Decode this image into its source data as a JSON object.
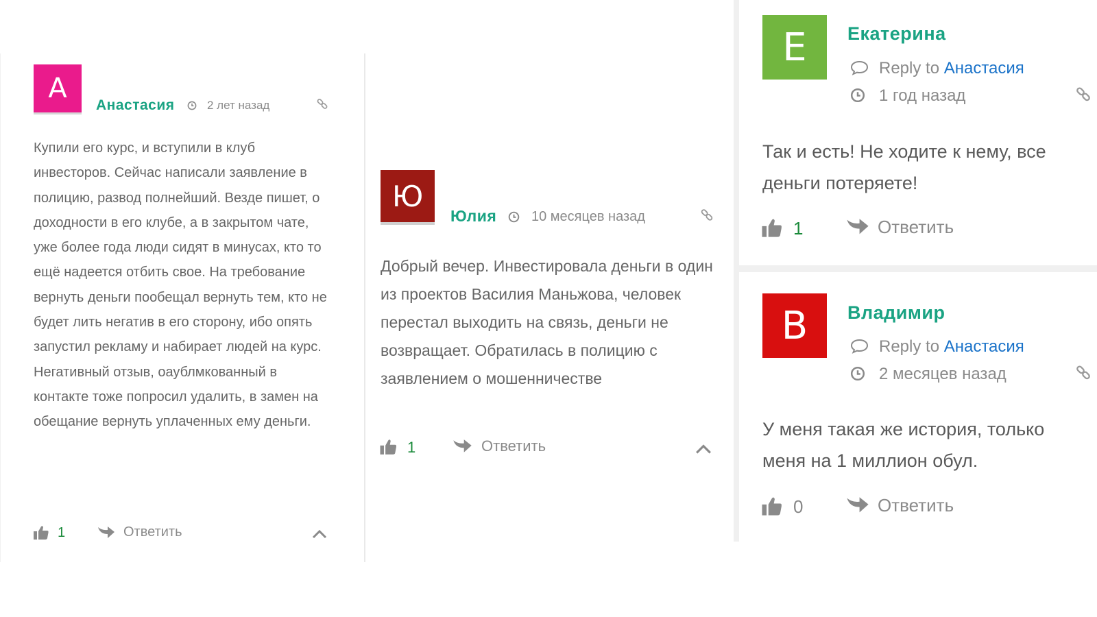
{
  "colors": {
    "author_green": "#1aa383",
    "reply_link_blue": "#1b73c9",
    "like_count_green": "#1a8a3a"
  },
  "icons": {
    "clock": "clock-icon",
    "link": "link-icon",
    "like": "thumbs-up-icon",
    "reply": "reply-arrow-icon",
    "collapse": "chevron-up-icon",
    "reply_to": "speech-bubble-icon"
  },
  "comments": [
    {
      "avatar_letter": "A",
      "avatar_color": "#ea1b8c",
      "author": "Анастасия",
      "time": "2 лет назад",
      "text": "Купили его курс, и вступили в клуб инвесторов. Сейчас написали заявление в полицию, развод полнейший. Везде пишет, о доходности в его клубе, а в закрытом чате, уже более года люди сидят в минусах, кто то ещё надеется отбить свое. На требование вернуть деньги пообещал вернуть тем, кто не будет лить негатив в его сторону, ибо опять запустил рекламу и набирает людей на курс. Негативный отзыв, оаублмкованный в контакте тоже попросил удалить, в замен на обещание вернуть уплаченных ему деньги.",
      "likes": "1",
      "reply_label": "Ответить"
    },
    {
      "avatar_letter": "Ю",
      "avatar_color": "#9c1a14",
      "author": "Юлия",
      "time": "10 месяцев назад",
      "text": "Добрый вечер. Инвестировала деньги в один из проектов Василия Маньжова, человек перестал выходить на связь, деньги не возвращает. Обратилась в полицию с заявлением о мошенничестве",
      "likes": "1",
      "reply_label": "Ответить"
    },
    {
      "avatar_letter": "Е",
      "avatar_color": "#72b63f",
      "author": "Екатерина",
      "reply_to_label": "Reply to",
      "reply_to_name": "Анастасия",
      "time": "1 год назад",
      "text": "Так и есть! Не ходите к нему, все деньги потеряете!",
      "likes": "1",
      "reply_label": "Ответить"
    },
    {
      "avatar_letter": "В",
      "avatar_color": "#d80f0f",
      "author": "Владимир",
      "reply_to_label": "Reply to",
      "reply_to_name": "Анастасия",
      "time": "2 месяцев назад",
      "text": "У меня такая же история, только меня на 1 миллион обул.",
      "likes": "0",
      "reply_label": "Ответить"
    }
  ]
}
